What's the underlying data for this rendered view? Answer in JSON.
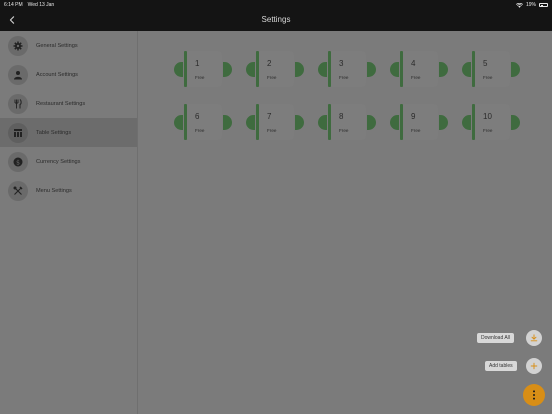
{
  "status_bar": {
    "time": "6:14 PM",
    "date": "Wed 13 Jan",
    "battery": "19%"
  },
  "nav": {
    "title": "Settings",
    "back_icon": "chevron-left-icon"
  },
  "sidebar": {
    "items": [
      {
        "label": "General Settings",
        "icon": "gear-icon",
        "active": false
      },
      {
        "label": "Account Settings",
        "icon": "user-icon",
        "active": false
      },
      {
        "label": "Restaurant Settings",
        "icon": "utensils-icon",
        "active": false
      },
      {
        "label": "Table Settings",
        "icon": "table-grid-icon",
        "active": true
      },
      {
        "label": "Currency Settings",
        "icon": "dollar-icon",
        "active": false
      },
      {
        "label": "Menu Settings",
        "icon": "crossed-utensils-icon",
        "active": false
      }
    ]
  },
  "tables": [
    {
      "number": "1",
      "status": "Free"
    },
    {
      "number": "2",
      "status": "Free"
    },
    {
      "number": "3",
      "status": "Free"
    },
    {
      "number": "4",
      "status": "Free"
    },
    {
      "number": "5",
      "status": "Free"
    },
    {
      "number": "6",
      "status": "Free"
    },
    {
      "number": "7",
      "status": "Free"
    },
    {
      "number": "8",
      "status": "Free"
    },
    {
      "number": "9",
      "status": "Free"
    },
    {
      "number": "10",
      "status": "Free"
    }
  ],
  "fab_menu": {
    "download_label": "Download All",
    "add_label": "Add tables",
    "accent": "#f0a020"
  }
}
